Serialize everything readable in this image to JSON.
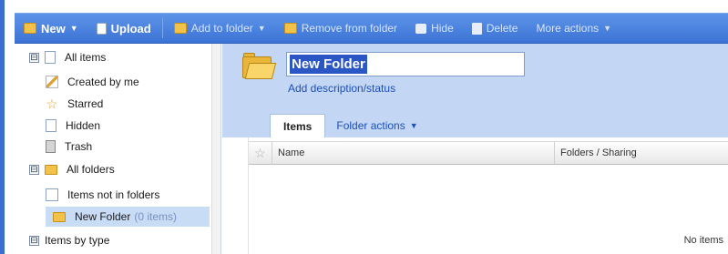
{
  "toolbar": {
    "new_label": "New",
    "upload_label": "Upload",
    "add_to_folder_label": "Add to folder",
    "remove_from_folder_label": "Remove from folder",
    "hide_label": "Hide",
    "delete_label": "Delete",
    "more_actions_label": "More actions"
  },
  "sidebar": {
    "all_items": "All items",
    "created_by_me": "Created by me",
    "starred": "Starred",
    "hidden": "Hidden",
    "trash": "Trash",
    "all_folders": "All folders",
    "items_not_in_folders": "Items not in folders",
    "new_folder": "New Folder",
    "new_folder_count": "(0 items)",
    "items_by_type": "Items by type"
  },
  "folder": {
    "name_value": "New Folder",
    "add_description": "Add description/status"
  },
  "tabs": {
    "items": "Items",
    "folder_actions": "Folder actions"
  },
  "columns": {
    "name": "Name",
    "folders_sharing": "Folders / Sharing"
  },
  "list": {
    "empty_text": "No items"
  },
  "icons": {
    "toggle_minus": "⊟",
    "star": "☆",
    "dropdown_caret": "▼"
  }
}
